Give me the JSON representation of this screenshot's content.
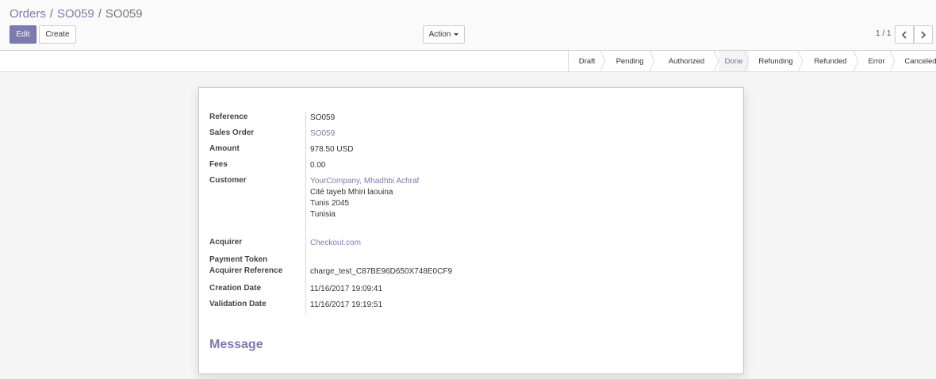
{
  "breadcrumb": {
    "items": [
      "Orders",
      "SO059"
    ],
    "current": "SO059"
  },
  "toolbar": {
    "edit_label": "Edit",
    "create_label": "Create",
    "action_label": "Action"
  },
  "pager": {
    "value": "1 / 1"
  },
  "status_steps": [
    "Draft",
    "Pending",
    "Authorized",
    "Done",
    "Refunding",
    "Refunded",
    "Error",
    "Canceled"
  ],
  "status_active": "Done",
  "fields": {
    "reference_label": "Reference",
    "reference_value": "SO059",
    "sales_order_label": "Sales Order",
    "sales_order_value": "SO059",
    "amount_label": "Amount",
    "amount_value": "978.50 USD",
    "fees_label": "Fees",
    "fees_value": "0.00",
    "customer_label": "Customer",
    "customer_name": "YourCompany, Mhadhbi Achraf",
    "customer_address": [
      "Cité tayeb Mhiri laouina",
      "Tunis 2045",
      "Tunisia"
    ],
    "acquirer_label": "Acquirer",
    "acquirer_value": "Checkout.com",
    "payment_token_label": "Payment Token",
    "acquirer_ref_label": "Acquirer Reference",
    "acquirer_ref_value": "charge_test_C87BE96D650X748E0CF9",
    "creation_date_label": "Creation Date",
    "creation_date_value": "11/16/2017 19:09:41",
    "validation_date_label": "Validation Date",
    "validation_date_value": "11/16/2017 19:19:51"
  },
  "message_title": "Message",
  "colors": {
    "accent": "#7c7bad"
  }
}
